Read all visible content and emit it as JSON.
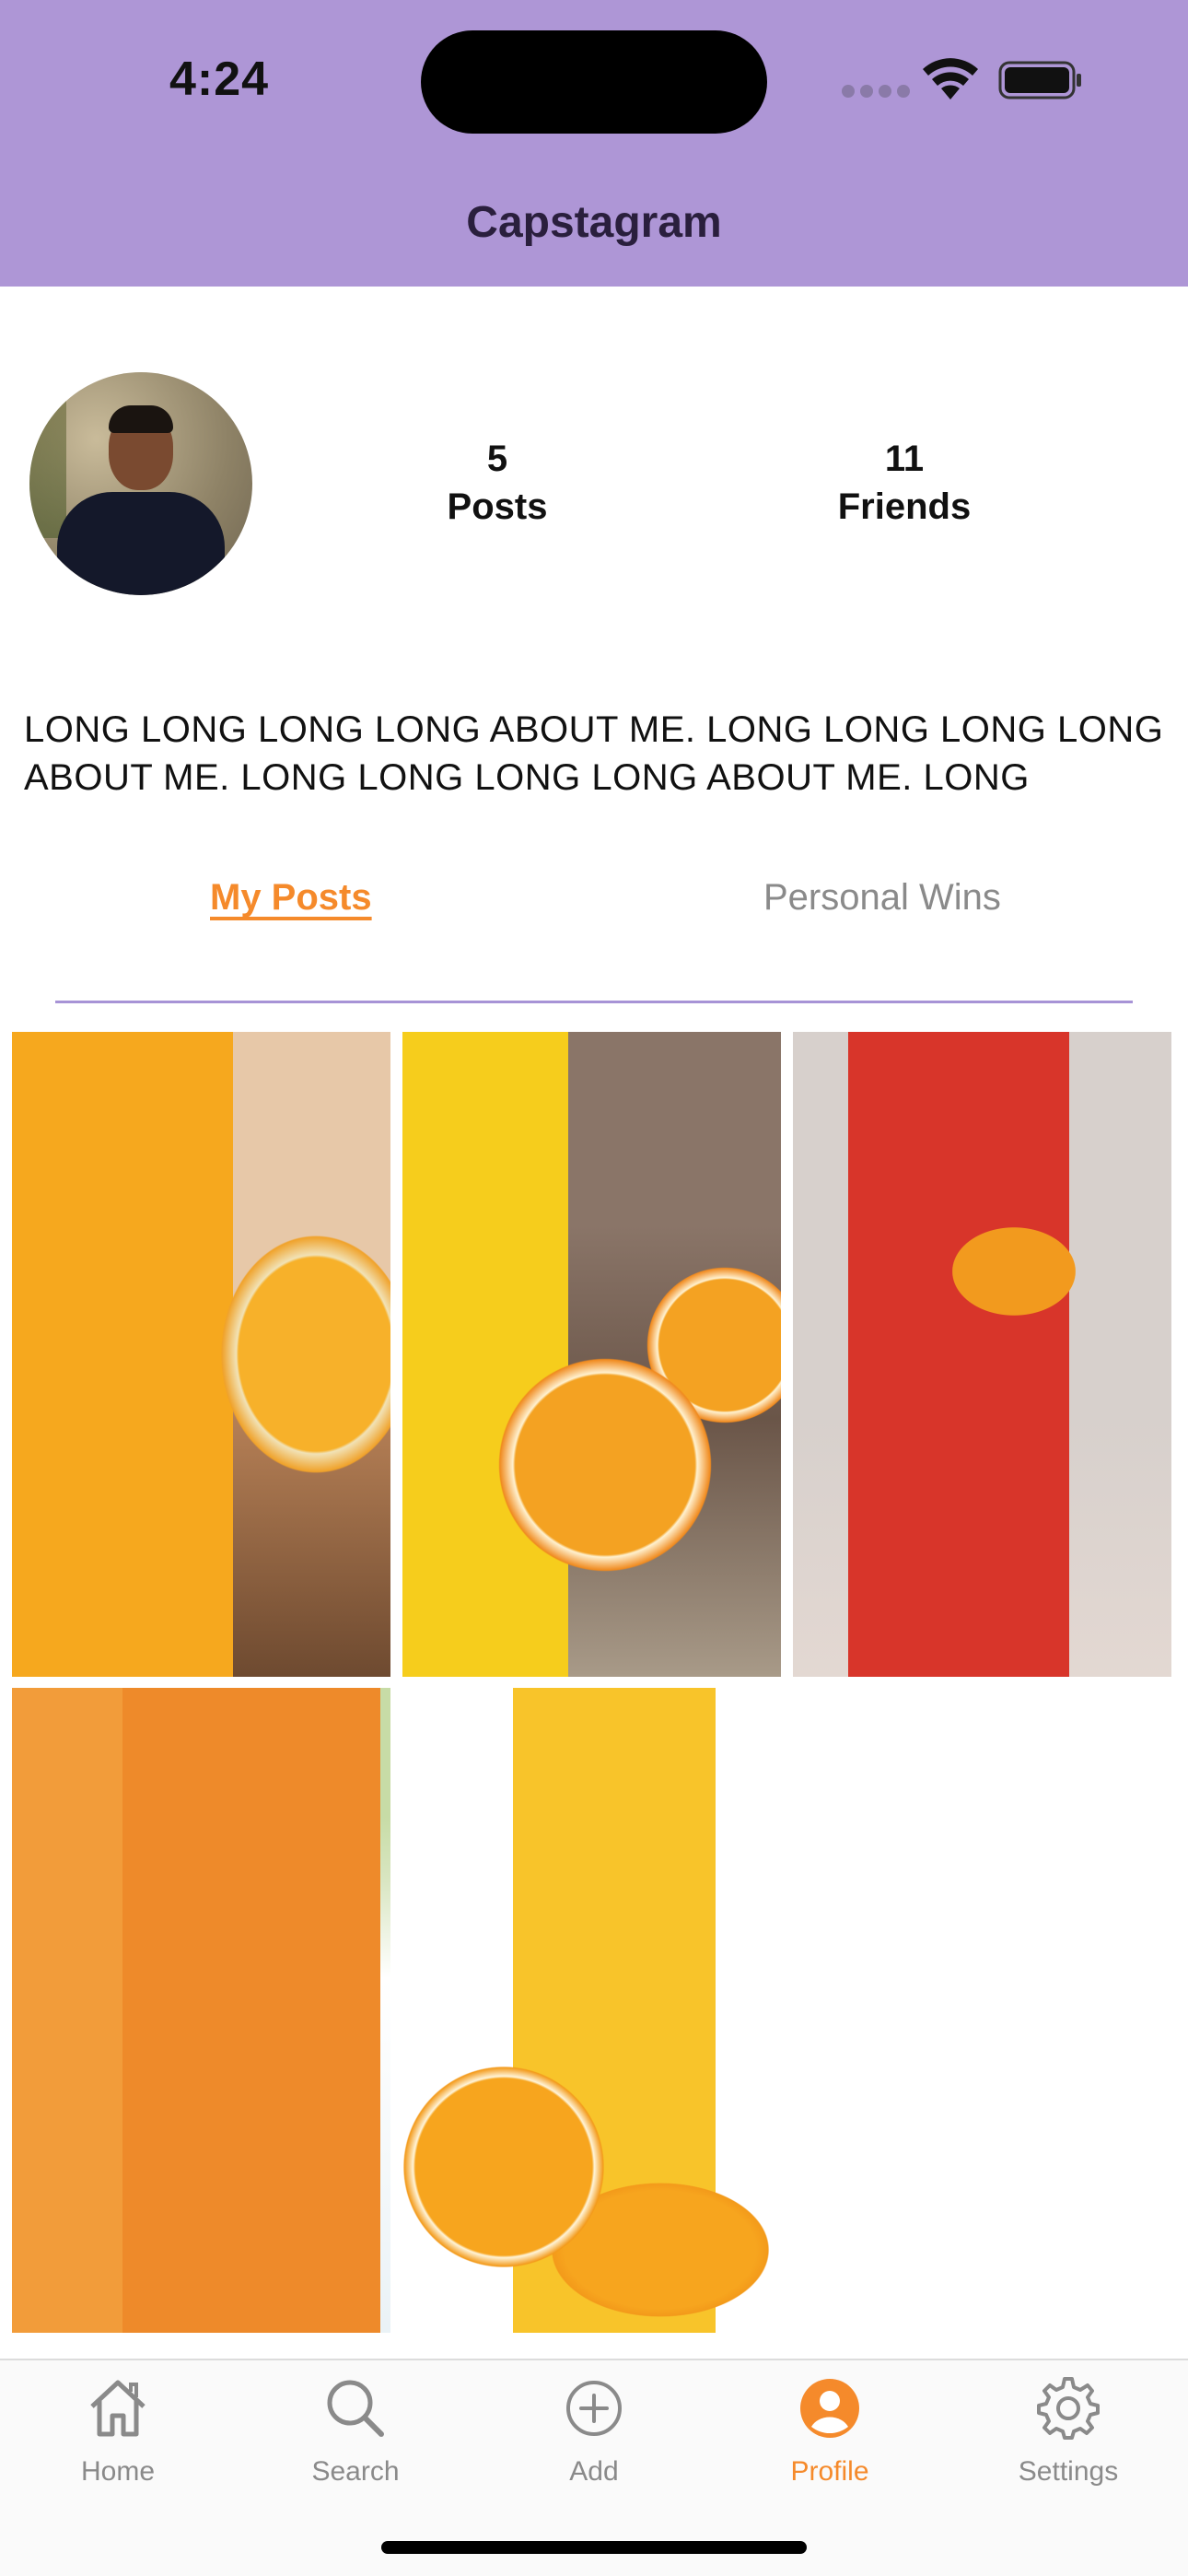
{
  "status_bar": {
    "time": "4:24"
  },
  "header": {
    "title": "Capstagram",
    "background_color": "#ae96d6"
  },
  "profile": {
    "posts_count": "5",
    "posts_label": "Posts",
    "friends_count": "11",
    "friends_label": "Friends",
    "about": "LONG LONG LONG LONG ABOUT ME. LONG LONG LONG LONG ABOUT ME. LONG LONG LONG LONG ABOUT ME. LONG"
  },
  "tabs": {
    "my_posts": "My Posts",
    "personal_wins": "Personal Wins",
    "active_color": "#f58a2b"
  },
  "posts": [
    {
      "name": "post-image-1"
    },
    {
      "name": "post-image-2"
    },
    {
      "name": "post-image-3"
    },
    {
      "name": "post-image-4"
    },
    {
      "name": "post-image-5"
    }
  ],
  "tab_bar": {
    "home": "Home",
    "search": "Search",
    "add": "Add",
    "profile": "Profile",
    "settings": "Settings",
    "active_tab": "Profile"
  }
}
